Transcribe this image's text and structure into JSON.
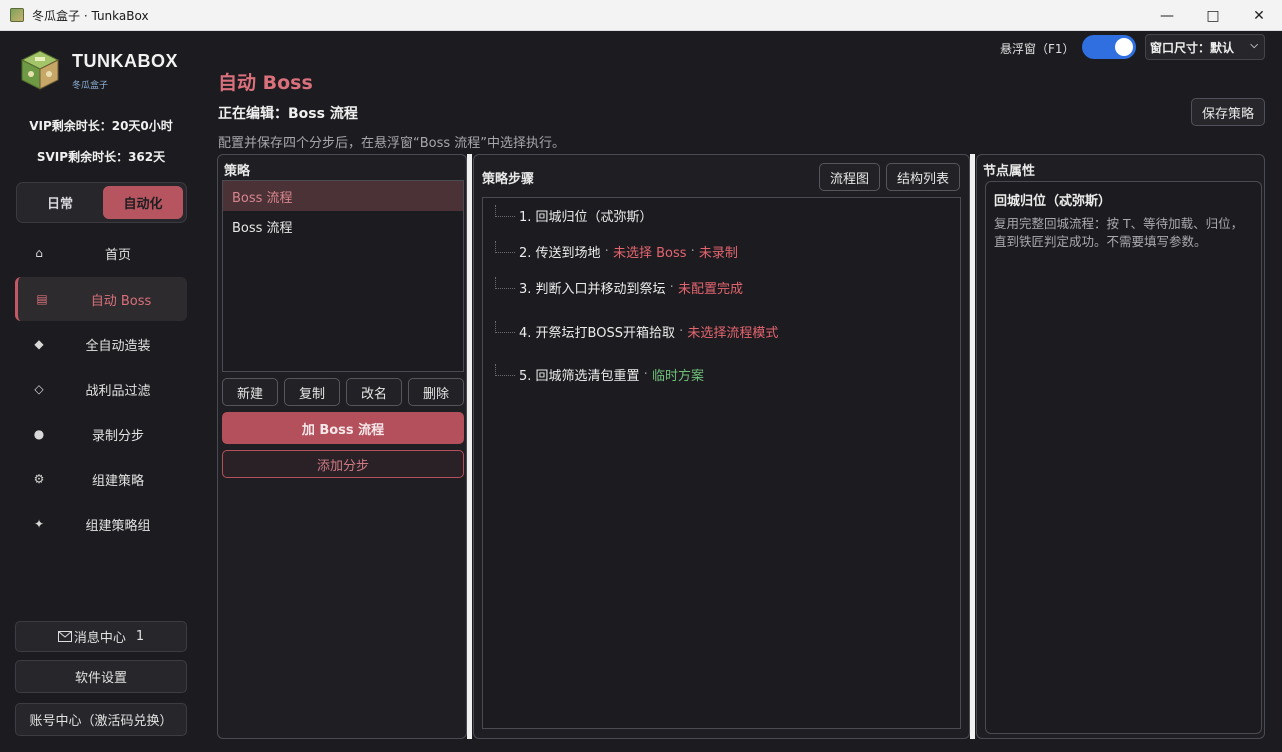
{
  "window": {
    "title": "冬瓜盒子 · TunkaBox"
  },
  "sidebar": {
    "brand": "TUNKABOX",
    "brand_sub": "冬瓜盒子",
    "vip": "VIP剩余时长：20天0小时",
    "svip": "SVIP剩余时长：362天",
    "mode_tabs": [
      "日常",
      "自动化"
    ],
    "nav": [
      {
        "icon": "⌂",
        "label": "首页"
      },
      {
        "icon": "▤",
        "label": "自动 Boss"
      },
      {
        "icon": "◆",
        "label": "全自动造装"
      },
      {
        "icon": "◇",
        "label": "战利品过滤"
      },
      {
        "icon": "●",
        "label": "录制分步"
      },
      {
        "icon": "⚙",
        "label": "组建策略"
      },
      {
        "icon": "✦",
        "label": "组建策略组"
      }
    ],
    "messages_label": "消息中心",
    "messages_count": "1",
    "settings_label": "软件设置",
    "account_label": "账号中心（激活码兑换）"
  },
  "header": {
    "title": "自动 Boss",
    "editing": "正在编辑：Boss 流程",
    "description": "配置并保存四个分步后，在悬浮窗“Boss 流程”中选择执行。",
    "float_label": "悬浮窗（F1）",
    "window_size": "窗口尺寸：默认",
    "save_button": "保存策略"
  },
  "strategy_panel": {
    "title": "策略",
    "items": [
      "Boss 流程",
      "Boss 流程"
    ],
    "buttons": [
      "新建",
      "复制",
      "改名",
      "删除"
    ],
    "primary": "加 Boss 流程",
    "secondary": "添加分步"
  },
  "steps_panel": {
    "title": "策略步骤",
    "flow_btn": "流程图",
    "struct_btn": "结构列表",
    "steps": [
      {
        "text": "1. 回城归位（忒弥斯）",
        "tags": []
      },
      {
        "text": "2. 传送到场地",
        "tags": [
          {
            "t": "未选择 Boss",
            "c": "warn"
          },
          {
            "t": "未录制",
            "c": "warn"
          }
        ]
      },
      {
        "text": "3. 判断入口并移动到祭坛",
        "tags": [
          {
            "t": "未配置完成",
            "c": "warn"
          }
        ]
      },
      {
        "text": "4. 开祭坛打BOSS开箱拾取",
        "tags": [
          {
            "t": "未选择流程模式",
            "c": "warn"
          }
        ]
      },
      {
        "text": "5. 回城筛选清包重置",
        "tags": [
          {
            "t": "临时方案",
            "c": "ok"
          }
        ]
      }
    ]
  },
  "props_panel": {
    "title": "节点属性",
    "node_title": "回城归位（忒弥斯）",
    "node_desc": "复用完整回城流程：按 T、等待加载、归位，直到铁匠判定成功。不需要填写参数。"
  },
  "colors": {
    "accent": "#b4505c",
    "accent_text": "#d9707b",
    "toggle": "#2f6fe0",
    "warn": "#e3646f",
    "ok": "#6fbf7a"
  }
}
